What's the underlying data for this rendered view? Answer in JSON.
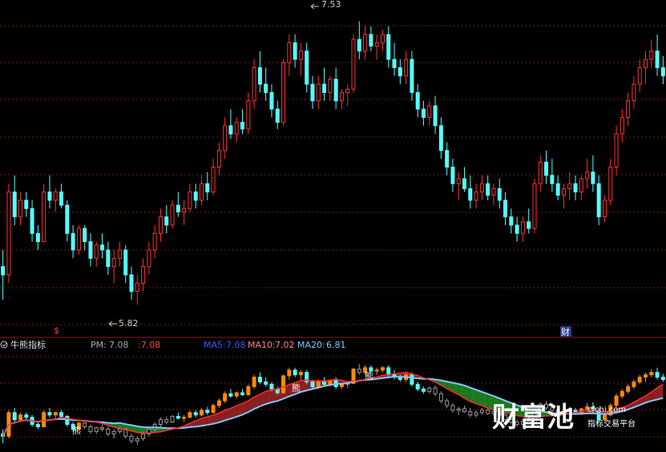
{
  "indicator": {
    "name": "牛熊指标",
    "pm_label": "PM:",
    "pm_value": "7.08",
    "pm_value2": ":7.08"
  },
  "ma": [
    {
      "label": "MA5:",
      "value": "7.08",
      "color": "#3b5bff"
    },
    {
      "label": "MA10:",
      "value": "7.02",
      "color": "#ff5a5a"
    },
    {
      "label": "MA20:",
      "value": "6.81",
      "color": "#7ec8ff"
    }
  ],
  "markers": {
    "dollar": "$",
    "cai": "财",
    "xiong": "熊"
  },
  "watermark": {
    "brand": "财富池",
    "url": "cfchi.com",
    "slogan": "指标交易平台"
  },
  "colors": {
    "up": "#ff3030",
    "down": "#54ffff",
    "grid": "#7a1a1a",
    "border": "#8b1a1a",
    "ma_red": "#ff2a2a",
    "ma_blue": "#7ec8ff",
    "fill_red": "#8b2020",
    "fill_green": "#1f7a1f"
  },
  "chart_data": {
    "type": "candlestick",
    "high_label": "7.53",
    "low_label": "5.82",
    "ylim": [
      5.7,
      7.6
    ],
    "candles": [
      [
        6.05,
        6.15,
        5.85,
        6.0
      ],
      [
        6.0,
        6.55,
        5.95,
        6.5
      ],
      [
        6.5,
        6.6,
        6.3,
        6.35
      ],
      [
        6.35,
        6.5,
        6.3,
        6.45
      ],
      [
        6.45,
        6.5,
        6.35,
        6.4
      ],
      [
        6.4,
        6.45,
        6.2,
        6.25
      ],
      [
        6.25,
        6.3,
        6.15,
        6.2
      ],
      [
        6.2,
        6.55,
        6.2,
        6.5
      ],
      [
        6.5,
        6.6,
        6.4,
        6.45
      ],
      [
        6.45,
        6.52,
        6.38,
        6.5
      ],
      [
        6.5,
        6.55,
        6.4,
        6.42
      ],
      [
        6.42,
        6.45,
        6.2,
        6.25
      ],
      [
        6.25,
        6.3,
        6.1,
        6.15
      ],
      [
        6.15,
        6.3,
        6.12,
        6.28
      ],
      [
        6.28,
        6.3,
        6.15,
        6.2
      ],
      [
        6.2,
        6.25,
        6.05,
        6.1
      ],
      [
        6.1,
        6.2,
        6.05,
        6.18
      ],
      [
        6.18,
        6.25,
        6.1,
        6.15
      ],
      [
        6.15,
        6.2,
        6.0,
        6.05
      ],
      [
        6.05,
        6.15,
        5.95,
        6.1
      ],
      [
        6.1,
        6.2,
        6.05,
        6.15
      ],
      [
        6.15,
        6.18,
        5.95,
        6.0
      ],
      [
        6.0,
        6.05,
        5.85,
        5.9
      ],
      [
        5.9,
        6.0,
        5.82,
        5.95
      ],
      [
        5.95,
        6.1,
        5.9,
        6.05
      ],
      [
        6.05,
        6.2,
        6.0,
        6.15
      ],
      [
        6.15,
        6.3,
        6.1,
        6.25
      ],
      [
        6.25,
        6.4,
        6.2,
        6.35
      ],
      [
        6.35,
        6.42,
        6.25,
        6.3
      ],
      [
        6.3,
        6.45,
        6.28,
        6.42
      ],
      [
        6.42,
        6.5,
        6.35,
        6.38
      ],
      [
        6.38,
        6.45,
        6.3,
        6.4
      ],
      [
        6.4,
        6.55,
        6.38,
        6.5
      ],
      [
        6.5,
        6.55,
        6.4,
        6.45
      ],
      [
        6.45,
        6.6,
        6.42,
        6.55
      ],
      [
        6.55,
        6.62,
        6.45,
        6.5
      ],
      [
        6.5,
        6.7,
        6.48,
        6.65
      ],
      [
        6.65,
        6.8,
        6.6,
        6.75
      ],
      [
        6.75,
        6.95,
        6.7,
        6.9
      ],
      [
        6.9,
        7.0,
        6.82,
        6.85
      ],
      [
        6.85,
        6.95,
        6.8,
        6.92
      ],
      [
        6.92,
        7.0,
        6.85,
        6.88
      ],
      [
        6.88,
        7.1,
        6.85,
        7.05
      ],
      [
        7.05,
        7.3,
        7.0,
        7.25
      ],
      [
        7.25,
        7.35,
        7.1,
        7.15
      ],
      [
        7.15,
        7.25,
        7.05,
        7.1
      ],
      [
        7.1,
        7.15,
        6.95,
        7.0
      ],
      [
        7.0,
        7.05,
        6.88,
        6.92
      ],
      [
        6.92,
        7.3,
        6.9,
        7.28
      ],
      [
        7.28,
        7.45,
        7.2,
        7.4
      ],
      [
        7.4,
        7.45,
        7.25,
        7.3
      ],
      [
        7.3,
        7.4,
        7.2,
        7.35
      ],
      [
        7.35,
        7.4,
        7.1,
        7.15
      ],
      [
        7.15,
        7.2,
        7.0,
        7.05
      ],
      [
        7.05,
        7.2,
        7.0,
        7.15
      ],
      [
        7.15,
        7.25,
        7.05,
        7.1
      ],
      [
        7.1,
        7.2,
        7.05,
        7.18
      ],
      [
        7.18,
        7.25,
        7.0,
        7.05
      ],
      [
        7.05,
        7.12,
        7.0,
        7.1
      ],
      [
        7.1,
        7.15,
        7.02,
        7.12
      ],
      [
        7.12,
        7.45,
        7.1,
        7.42
      ],
      [
        7.42,
        7.53,
        7.3,
        7.35
      ],
      [
        7.35,
        7.5,
        7.3,
        7.45
      ],
      [
        7.45,
        7.5,
        7.35,
        7.38
      ],
      [
        7.38,
        7.45,
        7.3,
        7.4
      ],
      [
        7.4,
        7.48,
        7.35,
        7.45
      ],
      [
        7.45,
        7.5,
        7.25,
        7.3
      ],
      [
        7.3,
        7.4,
        7.2,
        7.25
      ],
      [
        7.25,
        7.3,
        7.15,
        7.2
      ],
      [
        7.2,
        7.35,
        7.15,
        7.3
      ],
      [
        7.3,
        7.35,
        7.05,
        7.1
      ],
      [
        7.1,
        7.15,
        6.95,
        7.0
      ],
      [
        7.0,
        7.05,
        6.9,
        6.95
      ],
      [
        6.95,
        7.05,
        6.9,
        7.02
      ],
      [
        7.02,
        7.08,
        6.85,
        6.9
      ],
      [
        6.9,
        6.95,
        6.7,
        6.75
      ],
      [
        6.75,
        6.8,
        6.6,
        6.65
      ],
      [
        6.65,
        6.7,
        6.5,
        6.55
      ],
      [
        6.55,
        6.62,
        6.45,
        6.58
      ],
      [
        6.58,
        6.65,
        6.5,
        6.52
      ],
      [
        6.52,
        6.6,
        6.4,
        6.45
      ],
      [
        6.45,
        6.55,
        6.4,
        6.5
      ],
      [
        6.5,
        6.6,
        6.45,
        6.55
      ],
      [
        6.55,
        6.6,
        6.45,
        6.48
      ],
      [
        6.48,
        6.55,
        6.42,
        6.52
      ],
      [
        6.52,
        6.58,
        6.4,
        6.45
      ],
      [
        6.45,
        6.5,
        6.3,
        6.35
      ],
      [
        6.35,
        6.4,
        6.25,
        6.3
      ],
      [
        6.3,
        6.35,
        6.2,
        6.25
      ],
      [
        6.25,
        6.35,
        6.2,
        6.32
      ],
      [
        6.32,
        6.4,
        6.25,
        6.28
      ],
      [
        6.28,
        6.58,
        6.25,
        6.55
      ],
      [
        6.55,
        6.72,
        6.5,
        6.68
      ],
      [
        6.68,
        6.75,
        6.55,
        6.6
      ],
      [
        6.6,
        6.7,
        6.5,
        6.55
      ],
      [
        6.55,
        6.6,
        6.45,
        6.48
      ],
      [
        6.48,
        6.55,
        6.4,
        6.52
      ],
      [
        6.52,
        6.62,
        6.45,
        6.55
      ],
      [
        6.55,
        6.6,
        6.45,
        6.5
      ],
      [
        6.5,
        6.6,
        6.45,
        6.58
      ],
      [
        6.58,
        6.7,
        6.52,
        6.62
      ],
      [
        6.62,
        6.72,
        6.5,
        6.55
      ],
      [
        6.55,
        6.6,
        6.3,
        6.35
      ],
      [
        6.35,
        6.48,
        6.32,
        6.45
      ],
      [
        6.45,
        6.7,
        6.42,
        6.65
      ],
      [
        6.65,
        6.9,
        6.6,
        6.85
      ],
      [
        6.85,
        7.0,
        6.8,
        6.95
      ],
      [
        6.95,
        7.1,
        6.9,
        7.05
      ],
      [
        7.05,
        7.2,
        7.0,
        7.15
      ],
      [
        7.15,
        7.3,
        7.1,
        7.25
      ],
      [
        7.25,
        7.35,
        7.15,
        7.3
      ],
      [
        7.3,
        7.42,
        7.25,
        7.35
      ],
      [
        7.35,
        7.45,
        7.2,
        7.25
      ],
      [
        7.25,
        7.32,
        7.15,
        7.2
      ]
    ]
  }
}
